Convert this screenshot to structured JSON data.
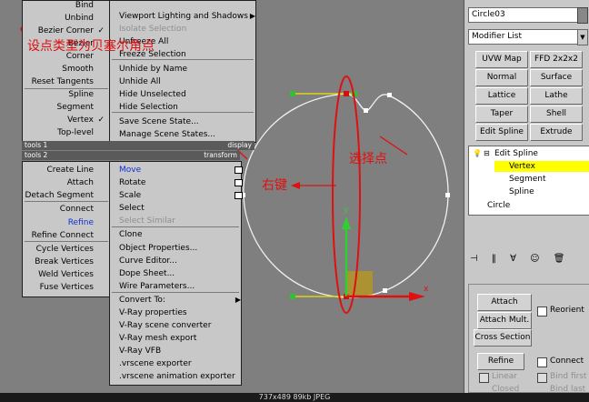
{
  "quad_top_left": {
    "items": [
      {
        "label": "Bind",
        "state": "normal"
      },
      {
        "label": "Unbind",
        "state": "normal"
      },
      {
        "label": "Bezier Corner",
        "state": "checked"
      },
      {
        "label": "Bezier",
        "state": "normal"
      },
      {
        "label": "Corner",
        "state": "normal"
      },
      {
        "label": "Smooth",
        "state": "normal"
      },
      {
        "label": "Reset Tangents",
        "state": "normal"
      },
      {
        "label": "Spline",
        "state": "normal"
      },
      {
        "label": "Segment",
        "state": "normal"
      },
      {
        "label": "Vertex",
        "state": "checked"
      },
      {
        "label": "Top-level",
        "state": "normal"
      }
    ],
    "footer_left": "tools 1",
    "footer_right": "display"
  },
  "quad_top_right": {
    "items": [
      {
        "label": "Viewport Lighting and Shadows",
        "state": "submenu"
      },
      {
        "label": "Isolate Selection",
        "state": "disabled"
      },
      {
        "label": "Unfreeze All",
        "state": "normal"
      },
      {
        "label": "Freeze Selection",
        "state": "normal"
      },
      {
        "label": "Unhide by Name",
        "state": "normal"
      },
      {
        "label": "Unhide All",
        "state": "normal"
      },
      {
        "label": "Hide Unselected",
        "state": "normal"
      },
      {
        "label": "Hide Selection",
        "state": "normal"
      },
      {
        "label": "Save Scene State...",
        "state": "normal"
      },
      {
        "label": "Manage Scene States...",
        "state": "normal"
      }
    ]
  },
  "quad_bottom_left": {
    "header": "tools 2",
    "items": [
      {
        "label": "Create Line",
        "state": "normal"
      },
      {
        "label": "Attach",
        "state": "normal"
      },
      {
        "label": "Detach Segment",
        "state": "normal"
      },
      {
        "label": "Connect",
        "state": "normal"
      },
      {
        "label": "Refine",
        "state": "blue"
      },
      {
        "label": "Refine Connect",
        "state": "normal"
      },
      {
        "label": "Cycle Vertices",
        "state": "normal"
      },
      {
        "label": "Break Vertices",
        "state": "normal"
      },
      {
        "label": "Weld Vertices",
        "state": "normal"
      },
      {
        "label": "Fuse Vertices",
        "state": "normal"
      }
    ]
  },
  "quad_bottom_right": {
    "header": "transform",
    "items": [
      {
        "label": "Move",
        "state": "blue-box"
      },
      {
        "label": "Rotate",
        "state": "box"
      },
      {
        "label": "Scale",
        "state": "box"
      },
      {
        "label": "Select",
        "state": "normal"
      },
      {
        "label": "Select Similar",
        "state": "disabled"
      },
      {
        "label": "Clone",
        "state": "normal"
      },
      {
        "label": "Object Properties...",
        "state": "normal"
      },
      {
        "label": "Curve Editor...",
        "state": "normal"
      },
      {
        "label": "Dope Sheet...",
        "state": "normal"
      },
      {
        "label": "Wire Parameters...",
        "state": "normal"
      },
      {
        "label": "Convert To:",
        "state": "submenu"
      },
      {
        "label": "V-Ray properties",
        "state": "normal"
      },
      {
        "label": "V-Ray scene converter",
        "state": "normal"
      },
      {
        "label": "V-Ray mesh export",
        "state": "normal"
      },
      {
        "label": "V-Ray VFB",
        "state": "normal"
      },
      {
        "label": ".vrscene exporter",
        "state": "normal"
      },
      {
        "label": ".vrscene animation exporter",
        "state": "normal"
      }
    ]
  },
  "annotations": {
    "bezier_corner_note": "设点类型为贝塞尔角点",
    "right_click_note": "右键",
    "select_point_note": "选择点"
  },
  "axes": {
    "x": "x",
    "y": "y"
  },
  "panel": {
    "object_name": "Circle03",
    "modifier_list": "Modifier List",
    "modifier_buttons": [
      "UVW Map",
      "FFD 2x2x2",
      "Normal",
      "Surface",
      "Lattice",
      "Lathe",
      "Taper",
      "Shell",
      "Edit Spline",
      "Extrude"
    ],
    "stack": {
      "root": "Edit Spline",
      "children": [
        "Vertex",
        "Segment",
        "Spline"
      ],
      "selected": "Vertex",
      "base": "Circle"
    },
    "geometry_buttons": [
      "Attach",
      "Attach Mult.",
      "Cross Section",
      "Refine",
      "Connect"
    ],
    "reorient_label": "Reorient",
    "linear_label": "Linear",
    "bind_first_label": "Bind first",
    "closed_label": "Closed",
    "bind_last_label": "Bind last"
  },
  "status_text": "737x489 89kb JPEG",
  "colors": {
    "annotation": "#e01010",
    "selection": "#ffff00",
    "viewport": "#7f7f7f",
    "panel": "#c8c8c8"
  }
}
